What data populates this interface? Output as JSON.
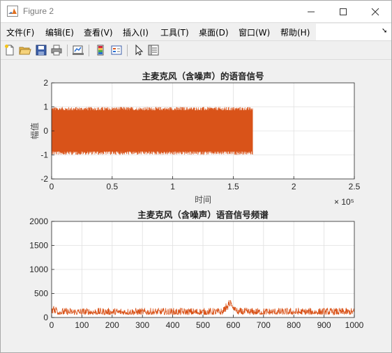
{
  "window": {
    "title": "Figure 2"
  },
  "menubar": {
    "items": [
      {
        "label": "文件(F)"
      },
      {
        "label": "编辑(E)"
      },
      {
        "label": "查看(V)"
      },
      {
        "label": "插入(I)"
      },
      {
        "label": "工具(T)"
      },
      {
        "label": "桌面(D)"
      },
      {
        "label": "窗口(W)"
      },
      {
        "label": "帮助(H)"
      }
    ]
  },
  "toolbar": {
    "icons": [
      "new-figure-icon",
      "open-file-icon",
      "save-icon",
      "print-icon",
      "link-plot-icon",
      "colorbar-icon",
      "legend-icon",
      "edit-plot-icon",
      "property-inspector-icon"
    ]
  },
  "colors": {
    "line": "#d95319",
    "grid": "#e0e0e0",
    "axes_bg": "#ffffff"
  },
  "chart_data": [
    {
      "type": "line",
      "title": "主麦克风（含噪声）的语音信号",
      "xlabel": "时间",
      "ylabel": "幅值",
      "xlim": [
        0,
        250000
      ],
      "ylim": [
        -2,
        2
      ],
      "x_ticks": [
        "0",
        "0.5",
        "1",
        "1.5",
        "2",
        "2.5"
      ],
      "y_ticks": [
        "-2",
        "-1",
        "0",
        "1",
        "2"
      ],
      "x_exponent": "× 10⁵",
      "grid": true,
      "signal_extent": [
        0,
        166000
      ],
      "amplitude_range": [
        -1,
        1
      ]
    },
    {
      "type": "line",
      "title": "主麦克风（含噪声）语音信号频谱",
      "xlabel": "",
      "ylabel": "",
      "xlim": [
        0,
        1000
      ],
      "ylim": [
        0,
        2000
      ],
      "x_ticks": [
        "0",
        "100",
        "200",
        "300",
        "400",
        "500",
        "600",
        "700",
        "800",
        "900",
        "1000"
      ],
      "y_ticks": [
        "0",
        "500",
        "1000",
        "1500",
        "2000"
      ],
      "grid": true,
      "typical_magnitude": [
        60,
        200
      ],
      "peak": {
        "x": 590,
        "y": 430
      }
    }
  ]
}
